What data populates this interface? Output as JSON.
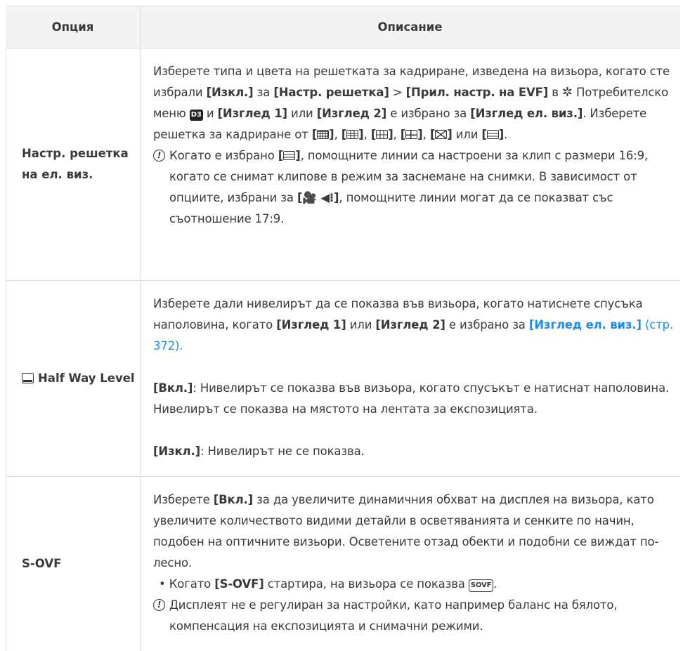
{
  "table": {
    "headers": {
      "option": "Опция",
      "description": "Описание"
    },
    "rows": [
      {
        "option": "Настр. решетка на ел. виз.",
        "desc": {
          "t1": "Изберете типа и цвета на решетката за кадриране, изведена на визьора, когато сте избрали ",
          "b1": "[Изкл.]",
          "t2": " за ",
          "b2": "[Настр. решетка]",
          "t3": " > ",
          "b3": "[Прил. настр. на EVF]",
          "t4": " в ",
          "t5": " Потребителско меню ",
          "menu_tab": "D3",
          "t6": " и ",
          "b4": "[Изглед 1]",
          "t7": " или ",
          "b5": "[Изглед 2]",
          "t8": " е избрано за ",
          "b6": "[Изглед ел. виз.]",
          "t9": ". Изберете решетка за кадриране от ",
          "sep": ", ",
          "or": " или ",
          "end": ".",
          "note_icon": "!",
          "note1": "Когато е избрано ",
          "note2": ", помощните линии са настроени за клип с размери 16:9, когато се снимат клипове в режим за заснемане на снимки. В зависимост от опциите, избрани за ",
          "note_b": "[🎥 ◀⁝]",
          "note3": ", помощните линии могат да се показват със съотношение 17:9."
        },
        "grid_icons": [
          "grid-4x4-icon",
          "grid-3x3-icon",
          "grid-3x3-alt-icon",
          "grid-center-icon",
          "grid-diagonal-icon",
          "grid-169-icon"
        ]
      },
      {
        "option": "Half Way Level",
        "desc": {
          "p1a": "Изберете дали нивелирът да се показва във визьора, когато натиснете спусъка наполовина, когато ",
          "b1": "[Изглед 1]",
          "p1b": " или ",
          "b2": "[Изглед 2]",
          "p1c": " е избрано за ",
          "link_b": "[Изглед ел. виз.]",
          "link_t": " (стр. 372)",
          "p1d": ".",
          "p2b": "[Вкл.]",
          "p2": ": Нивелирът се показва във визьора, когато спусъкът е натиснат наполовина. Нивелирът се показва на мястото на лентата за експозицията.",
          "p3b": "[Изкл.]",
          "p3": ": Нивелирът не се показва."
        }
      },
      {
        "option": "S-OVF",
        "desc": {
          "p1a": "Изберете ",
          "b1": "[Вкл.]",
          "p1b": " за да увеличите динамичния обхват на дисплея на визьора, като увеличите количеството видими детайли в осветяванията и сенките по начин, подобен на оптичните визьори. Осветените отзад обекти и подобни се виждат по-лесно.",
          "bullet_char": "•",
          "bul_a": "Когато ",
          "bul_b": "[S-OVF]",
          "bul_c": " стартира, на визьора се показва ",
          "sovf_icon": "SOVF",
          "bul_d": ".",
          "note_icon": "!",
          "note": "Дисплеят не е регулиран за настройки, като например баланс на бялото, компенсация на експозицията и снимачни режими."
        }
      }
    ]
  }
}
